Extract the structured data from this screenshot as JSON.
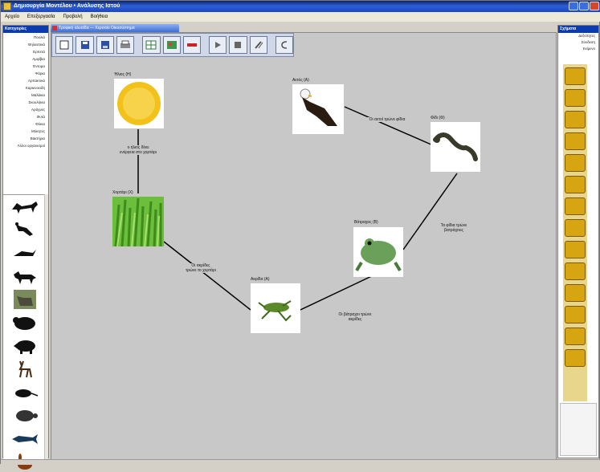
{
  "window": {
    "title": "Δημιουργία Μοντέλου • Ανάλυσης Ιστού"
  },
  "menu": [
    "Αρχείο",
    "Επεξεργασία",
    "Προβολή",
    "Βοήθεια"
  ],
  "left_panel": {
    "header": "Κατηγορίες",
    "categories": [
      "Πουλιά",
      "Θηλαστικά",
      "Ερπετά",
      "Αμφίβια",
      "Έντομα",
      "Ψάρια",
      "Αρπακτικά",
      "Καρκινοειδή",
      "Μαλάκια",
      "Σκουλήκια",
      "Αράχνες",
      "Φυτά",
      "Φύκια",
      "Μύκητες",
      "Βακτήρια",
      "Άλλοι οργανισμοί"
    ],
    "animals": [
      "fox",
      "eagle",
      "hawk",
      "wolf",
      "deer-photo",
      "bear",
      "boar",
      "deer",
      "rat",
      "tortoise",
      "fish",
      "rabbit"
    ]
  },
  "document_tab": "Τροφική αλυσίδα — Χερσαίο Οικοσύστημα",
  "toolbar": [
    "new-icon",
    "save-icon",
    "save-as-icon",
    "print-icon",
    "grid-icon",
    "image-icon",
    "color-icon",
    "play-icon",
    "stop-icon",
    "pen-icon",
    "undo-icon"
  ],
  "nodes": {
    "sun": {
      "label": "Ήλιος (Η)"
    },
    "grass": {
      "label": "Χορτάρι (Χ)"
    },
    "grasshopper": {
      "label": "Ακρίδα (Α)"
    },
    "frog": {
      "label": "Βάτραχος (Β)"
    },
    "snake": {
      "label": "Φίδι (Φ)"
    },
    "eagle": {
      "label": "Αετός (Α)"
    }
  },
  "edges": {
    "sun_grass": "ο ήλιος δίνει\nενέργεια στο χορτάρι",
    "grass_grasshopper": "Οι ακρίδες\nτρώνε το χορτάρι",
    "grasshopper_frog": "Οι βάτραχοι τρώνε\nακρίδες",
    "frog_snake": "Τα φίδια τρώνε\nβατράχους",
    "snake_eagle": "Οι αετοί τρώνε φίδια"
  },
  "right_panel": {
    "header": "Σχήματα",
    "items": [
      "Δεξιότητες",
      "Σύνδεση",
      "Κείμενο"
    ],
    "shapes": 14
  },
  "colors": {
    "accent": "#0a3bb0",
    "canvas": "#c8c8c8",
    "shape": "#d8a512"
  }
}
